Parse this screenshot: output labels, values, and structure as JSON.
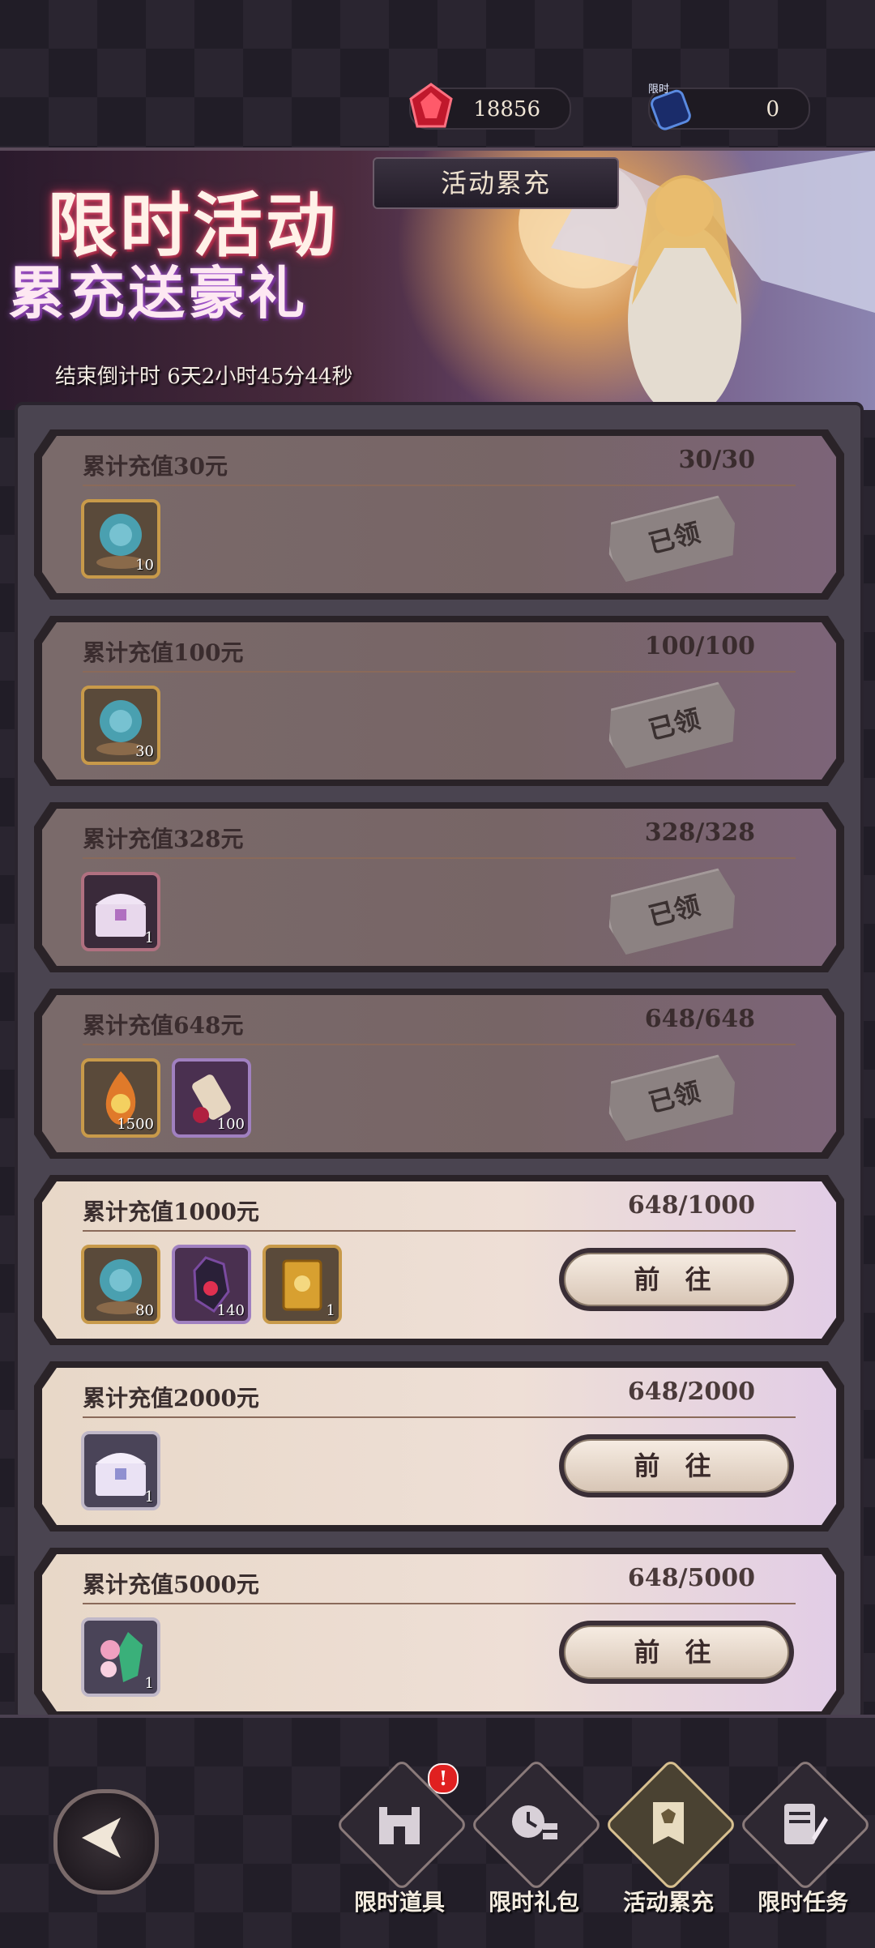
{
  "currencies": [
    {
      "icon": "red-gem-icon",
      "value": "18856"
    },
    {
      "icon": "limited-crystal-icon",
      "value": "0",
      "tag": "限时"
    }
  ],
  "banner": {
    "tab_label": "活动累充",
    "title_line1": "限时活动",
    "title_line2": "累充送豪礼",
    "countdown": "结束倒计时 6天2小时45分44秒"
  },
  "tiers": [
    {
      "label": "累计充值30元",
      "progress": "30/30",
      "state": "已领",
      "items": [
        {
          "icon": "crystal-ball-icon",
          "count": "10",
          "style": "gold"
        }
      ]
    },
    {
      "label": "累计充值100元",
      "progress": "100/100",
      "state": "已领",
      "items": [
        {
          "icon": "crystal-ball-icon",
          "count": "30",
          "style": "gold"
        }
      ]
    },
    {
      "label": "累计充值328元",
      "progress": "328/328",
      "state": "已领",
      "items": [
        {
          "icon": "treasure-chest-icon",
          "count": "1",
          "style": "red"
        }
      ]
    },
    {
      "label": "累计充值648元",
      "progress": "648/648",
      "state": "已领",
      "items": [
        {
          "icon": "fire-essence-icon",
          "count": "1500",
          "style": "gold"
        },
        {
          "icon": "scroll-icon",
          "count": "100",
          "style": "purple"
        }
      ]
    },
    {
      "label": "累计充值1000元",
      "progress": "648/1000",
      "state": "前 往",
      "items": [
        {
          "icon": "crystal-ball-icon",
          "count": "80",
          "style": "gold"
        },
        {
          "icon": "dark-crystal-icon",
          "count": "140",
          "style": "purple"
        },
        {
          "icon": "golden-book-icon",
          "count": "1",
          "style": "gold"
        }
      ]
    },
    {
      "label": "累计充值2000元",
      "progress": "648/2000",
      "state": "前 往",
      "items": [
        {
          "icon": "treasure-chest-icon",
          "count": "1",
          "style": "silver"
        }
      ]
    },
    {
      "label": "累计充值5000元",
      "progress": "648/5000",
      "state": "前 往",
      "items": [
        {
          "icon": "flower-gem-icon",
          "count": "1",
          "style": "silver"
        }
      ]
    }
  ],
  "nav": {
    "badge": "!",
    "items": [
      {
        "label": "限时道具",
        "icon": "castle-icon",
        "active": false
      },
      {
        "label": "限时礼包",
        "icon": "coin-clock-icon",
        "active": false
      },
      {
        "label": "活动累充",
        "icon": "banner-icon",
        "active": true
      },
      {
        "label": "限时任务",
        "icon": "task-pen-icon",
        "active": false
      }
    ]
  }
}
